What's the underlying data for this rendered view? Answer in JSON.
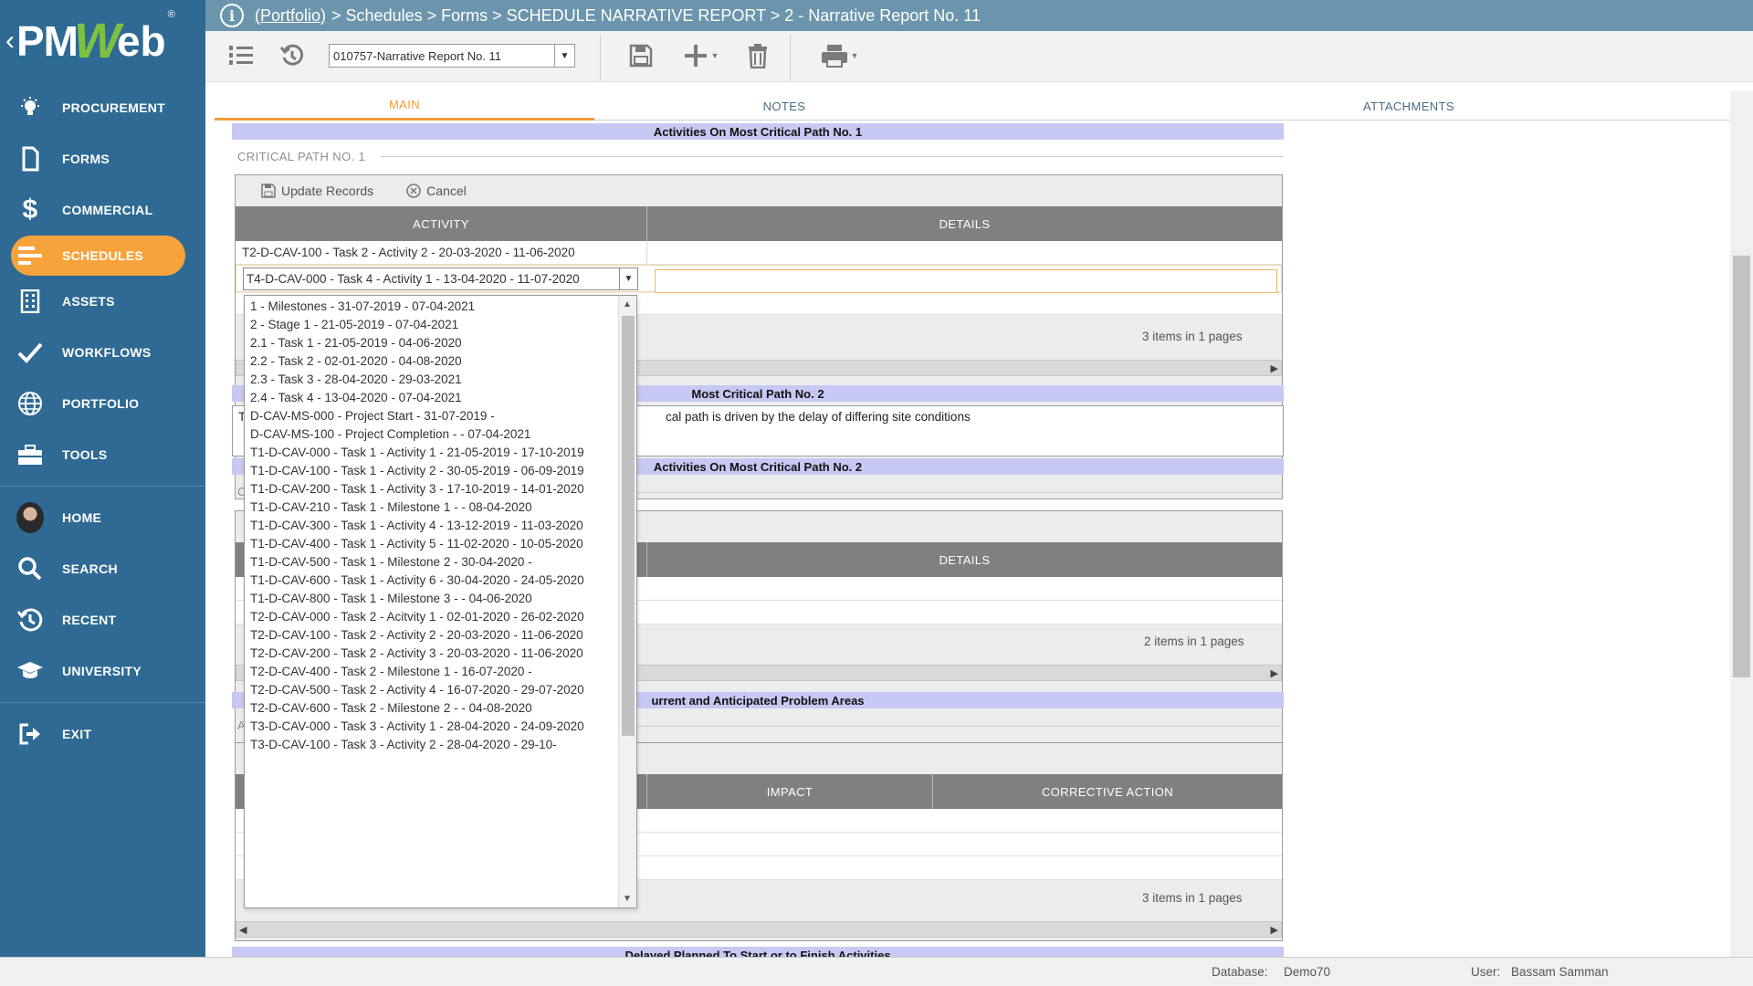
{
  "logo": {
    "text_pm": "PM",
    "text_w": "W",
    "text_eb": "eb",
    "reg": "®",
    "chev": "‹"
  },
  "sidebar": {
    "items": [
      {
        "label": "PROCUREMENT",
        "icon": "lightbulb-icon"
      },
      {
        "label": "FORMS",
        "icon": "document-icon"
      },
      {
        "label": "COMMERCIAL",
        "icon": "dollar-icon"
      },
      {
        "label": "SCHEDULES",
        "icon": "schedule-bars-icon",
        "active": true
      },
      {
        "label": "ASSETS",
        "icon": "building-icon"
      },
      {
        "label": "WORKFLOWS",
        "icon": "checkmark-icon"
      },
      {
        "label": "PORTFOLIO",
        "icon": "globe-icon"
      },
      {
        "label": "TOOLS",
        "icon": "toolbox-icon"
      }
    ],
    "items2": [
      {
        "label": "HOME",
        "icon": "avatar"
      },
      {
        "label": "SEARCH",
        "icon": "search-icon"
      },
      {
        "label": "RECENT",
        "icon": "history-icon"
      },
      {
        "label": "UNIVERSITY",
        "icon": "graduation-cap-icon"
      }
    ],
    "exit": {
      "label": "EXIT",
      "icon": "exit-icon"
    },
    "colors": {
      "bg": "#2e6a93",
      "active": "#f7a33c"
    }
  },
  "header": {
    "info_icon": "i",
    "breadcrumb_link": "(Portfolio)",
    "breadcrumb_rest": "> Schedules > Forms > SCHEDULE NARRATIVE REPORT > 2 - Narrative Report No. 11"
  },
  "toolbar": {
    "record_select": "010757-Narrative Report No. 11"
  },
  "tabs": [
    {
      "label": "MAIN",
      "active": true
    },
    {
      "label": "NOTES"
    },
    {
      "label": "ATTACHMENTS"
    }
  ],
  "section1": {
    "band": "Activities On Most Critical Path No. 1",
    "label": "CRITICAL PATH NO. 1",
    "update_label": "Update Records",
    "cancel_label": "Cancel",
    "col_activity": "ACTIVITY",
    "col_details": "DETAILS",
    "row1_activity": "T2-D-CAV-100 - Task 2 - Activity 2 - 20-03-2020 - 11-06-2020",
    "combo_value": "T4-D-CAV-000 - Task 4 - Activity 1 - 13-04-2020 - 11-07-2020",
    "pager": "3 items in 1 pages"
  },
  "section2": {
    "band_partial": "Most Critical Path No. 2",
    "textarea_left": "T",
    "textarea_text": "cal path is driven by the delay of differing site conditions"
  },
  "section3": {
    "band_partial": "Activities On Most Critical Path No. 2",
    "label_partial": "C",
    "col_details": "DETAILS",
    "pager": "2 items in 1 pages"
  },
  "section4": {
    "band_partial": "urrent and Anticipated Problem Areas",
    "label_partial": "A",
    "col_impact": "IMPACT",
    "col_corrective": "CORRECTIVE ACTION",
    "pager": "3 items in 1 pages"
  },
  "section5": {
    "band_partial": "Delayed Planned To Start or to Finish Activities"
  },
  "dropdown": {
    "options": [
      "1 - Milestones - 31-07-2019 - 07-04-2021",
      "2 - Stage 1 - 21-05-2019 - 07-04-2021",
      "2.1 - Task 1 - 21-05-2019 - 04-06-2020",
      "2.2 - Task 2 - 02-01-2020 - 04-08-2020",
      "2.3 - Task 3 - 28-04-2020 - 29-03-2021",
      "2.4 - Task 4 - 13-04-2020 - 07-04-2021",
      "D-CAV-MS-000 - Project Start - 31-07-2019 -",
      "D-CAV-MS-100 - Project Completion - - 07-04-2021",
      "T1-D-CAV-000 - Task 1 - Activity 1 - 21-05-2019 - 17-10-2019",
      "T1-D-CAV-100 - Task 1 - Activity 2 - 30-05-2019 - 06-09-2019",
      "T1-D-CAV-200 - Task 1 - Activity 3 - 17-10-2019 - 14-01-2020",
      "T1-D-CAV-210 - Task 1 - Milestone 1 - - 08-04-2020",
      "T1-D-CAV-300 - Task 1 - Activity 4 - 13-12-2019 - 11-03-2020",
      "T1-D-CAV-400 - Task 1 - Activity 5 - 11-02-2020 - 10-05-2020",
      "T1-D-CAV-500 - Task 1 - Milestone 2 - 30-04-2020 -",
      "T1-D-CAV-600 - Task 1 - Activity 6 - 30-04-2020 - 24-05-2020",
      "T1-D-CAV-800 - Task 1 - Milestone 3 - - 04-06-2020",
      "T2-D-CAV-000 - Task 2 - Acitvity 1 - 02-01-2020 - 26-02-2020",
      "T2-D-CAV-100 - Task 2 - Activity 2 - 20-03-2020 - 11-06-2020",
      "T2-D-CAV-200 - Task 2 - Activity 3 - 20-03-2020 - 11-06-2020",
      "T2-D-CAV-400 - Task 2 - Milestone 1 - 16-07-2020 -",
      "T2-D-CAV-500 - Task 2 - Activity 4 - 16-07-2020 - 29-07-2020",
      "T2-D-CAV-600 - Task 2 - Milestone 2 - - 04-08-2020",
      "T3-D-CAV-000 - Task 3 - Activity 1 - 28-04-2020 - 24-09-2020",
      "T3-D-CAV-100 - Task 3 - Activity 2 - 28-04-2020 - 29-10-"
    ]
  },
  "status": {
    "db_label": "Database:",
    "db_value": "Demo70",
    "user_label": "User:",
    "user_value": "Bassam Samman"
  }
}
